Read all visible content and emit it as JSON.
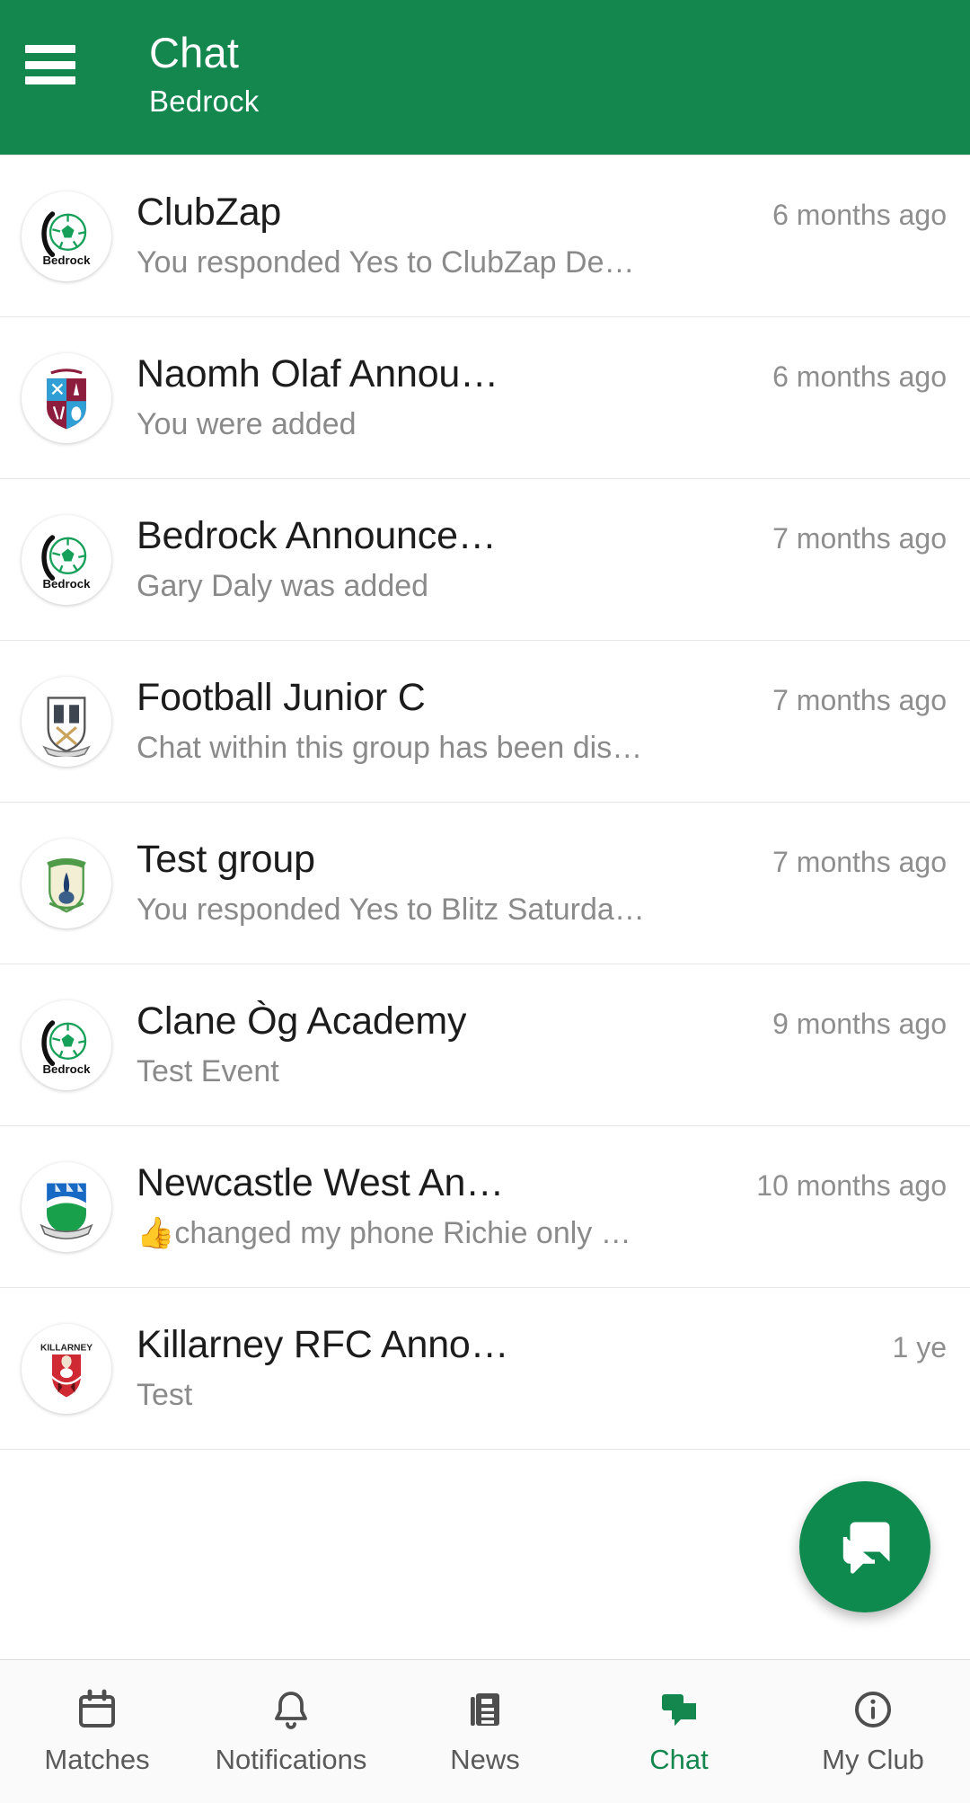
{
  "header": {
    "menu_icon": "hamburger-menu-icon",
    "title": "Chat",
    "subtitle": "Bedrock"
  },
  "chat_list": [
    {
      "avatar": "bedrock-football-logo",
      "title": "ClubZap",
      "time": "6 months ago",
      "preview": "You responded Yes to ClubZap De…"
    },
    {
      "avatar": "naomh-olaf-crest",
      "title": "Naomh Olaf Annou…",
      "time": "6 months ago",
      "preview": "You were added"
    },
    {
      "avatar": "bedrock-football-logo",
      "title": "Bedrock Announce…",
      "time": "7 months ago",
      "preview": "Gary Daly was added"
    },
    {
      "avatar": "football-junior-crest",
      "title": "Football Junior C",
      "time": "7 months ago",
      "preview": "Chat within this group has been dis…"
    },
    {
      "avatar": "test-group-crest",
      "title": "Test group",
      "time": "7 months ago",
      "preview": "You responded Yes to Blitz Saturda…"
    },
    {
      "avatar": "bedrock-football-logo",
      "title": "Clane Òg Academy",
      "time": "9 months ago",
      "preview": "Test Event"
    },
    {
      "avatar": "newcastle-west-crest",
      "title": "Newcastle West An…",
      "time": "10 months ago",
      "preview": "👍changed my phone Richie only …"
    },
    {
      "avatar": "killarney-rfc-crest",
      "title": "Killarney RFC Anno…",
      "time": "1 ye",
      "preview": "Test"
    }
  ],
  "fab": {
    "icon": "new-chat-icon",
    "color": "#0E8A4E"
  },
  "bottom_nav": {
    "active": "Chat",
    "items": [
      {
        "label": "Matches",
        "icon": "calendar-icon"
      },
      {
        "label": "Notifications",
        "icon": "bell-icon"
      },
      {
        "label": "News",
        "icon": "news-document-icon"
      },
      {
        "label": "Chat",
        "icon": "chat-bubbles-icon"
      },
      {
        "label": "My Club",
        "icon": "info-circle-icon"
      }
    ]
  },
  "colors": {
    "brand_green": "#14874F",
    "fab_green": "#0E8A4E",
    "title_text": "#1c1c1c",
    "muted_text": "#8a8a8a"
  }
}
